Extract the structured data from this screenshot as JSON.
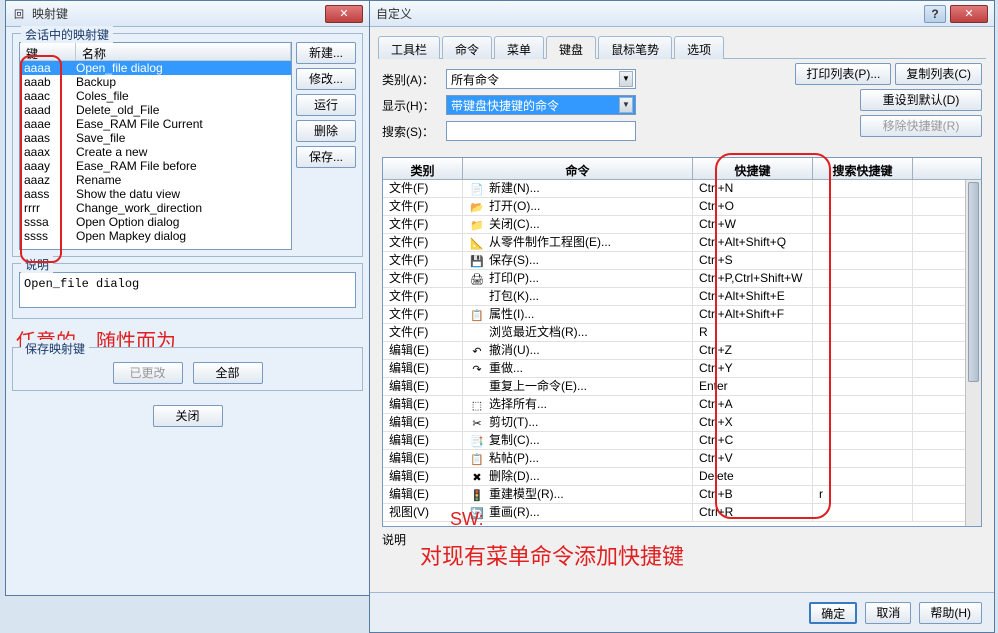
{
  "left": {
    "title": "映射键",
    "group_session": "会话中的映射键",
    "col_key": "键",
    "col_name": "名称",
    "rows": [
      {
        "k": "aaaa",
        "n": "Open_file dialog"
      },
      {
        "k": "aaab",
        "n": "Backup"
      },
      {
        "k": "aaac",
        "n": "Coles_file"
      },
      {
        "k": "aaad",
        "n": "Delete_old_File"
      },
      {
        "k": "aaae",
        "n": "Ease_RAM File Current"
      },
      {
        "k": "aaas",
        "n": "Save_file"
      },
      {
        "k": "aaax",
        "n": "Create a new"
      },
      {
        "k": "aaay",
        "n": "Ease_RAM File before"
      },
      {
        "k": "aaaz",
        "n": "Rename"
      },
      {
        "k": "aass",
        "n": "Show the datu view"
      },
      {
        "k": "rrrr",
        "n": "Change_work_direction"
      },
      {
        "k": "sssa",
        "n": "Open Option dialog"
      },
      {
        "k": "ssss",
        "n": "Open Mapkey dialog"
      }
    ],
    "btn_new": "新建...",
    "btn_edit": "修改...",
    "btn_run": "运行",
    "btn_del": "删除",
    "btn_save": "保存...",
    "group_desc": "说明",
    "desc_text": "Open_file dialog",
    "group_savekeys": "保存映射键",
    "btn_changed": "已更改",
    "btn_all": "全部",
    "btn_close": "关闭",
    "anno": "任意的，随性而为"
  },
  "right": {
    "title": "自定义",
    "tabs": [
      "工具栏",
      "命令",
      "菜单",
      "键盘",
      "鼠标笔势",
      "选项"
    ],
    "lbl_category": "类别(A)：",
    "val_category": "所有命令",
    "lbl_show": "显示(H)：",
    "val_show": "带键盘快捷键的命令",
    "lbl_search": "搜索(S)：",
    "btn_printlist": "打印列表(P)...",
    "btn_copylist": "复制列表(C)",
    "btn_reset": "重设到默认(D)",
    "btn_remove": "移除快捷键(R)",
    "grid_cols": [
      "类别",
      "命令",
      "快捷键",
      "搜索快捷键"
    ],
    "grid_rows": [
      {
        "c": "文件(F)",
        "ico": "📄",
        "cmd": "新建(N)...",
        "key": "Ctrl+N",
        "s": ""
      },
      {
        "c": "文件(F)",
        "ico": "📂",
        "cmd": "打开(O)...",
        "key": "Ctrl+O",
        "s": ""
      },
      {
        "c": "文件(F)",
        "ico": "📁",
        "cmd": "关闭(C)...",
        "key": "Ctrl+W",
        "s": ""
      },
      {
        "c": "文件(F)",
        "ico": "📐",
        "cmd": "从零件制作工程图(E)...",
        "key": "Ctrl+Alt+Shift+Q",
        "s": ""
      },
      {
        "c": "文件(F)",
        "ico": "💾",
        "cmd": "保存(S)...",
        "key": "Ctrl+S",
        "s": ""
      },
      {
        "c": "文件(F)",
        "ico": "🖨",
        "cmd": "打印(P)...",
        "key": "Ctrl+P,Ctrl+Shift+W",
        "s": ""
      },
      {
        "c": "文件(F)",
        "ico": "",
        "cmd": "打包(K)...",
        "key": "Ctrl+Alt+Shift+E",
        "s": ""
      },
      {
        "c": "文件(F)",
        "ico": "📋",
        "cmd": "属性(I)...",
        "key": "Ctrl+Alt+Shift+F",
        "s": ""
      },
      {
        "c": "文件(F)",
        "ico": "",
        "cmd": "浏览最近文档(R)...",
        "key": "R",
        "s": ""
      },
      {
        "c": "编辑(E)",
        "ico": "↶",
        "cmd": "撤消(U)...",
        "key": "Ctrl+Z",
        "s": ""
      },
      {
        "c": "编辑(E)",
        "ico": "↷",
        "cmd": "重做...",
        "key": "Ctrl+Y",
        "s": ""
      },
      {
        "c": "编辑(E)",
        "ico": "",
        "cmd": "重复上一命令(E)...",
        "key": "Enter",
        "s": ""
      },
      {
        "c": "编辑(E)",
        "ico": "⬚",
        "cmd": "选择所有...",
        "key": "Ctrl+A",
        "s": ""
      },
      {
        "c": "编辑(E)",
        "ico": "✂",
        "cmd": "剪切(T)...",
        "key": "Ctrl+X",
        "s": ""
      },
      {
        "c": "编辑(E)",
        "ico": "📑",
        "cmd": "复制(C)...",
        "key": "Ctrl+C",
        "s": ""
      },
      {
        "c": "编辑(E)",
        "ico": "📋",
        "cmd": "粘帖(P)...",
        "key": "Ctrl+V",
        "s": ""
      },
      {
        "c": "编辑(E)",
        "ico": "✖",
        "cmd": "删除(D)...",
        "key": "Delete",
        "s": ""
      },
      {
        "c": "编辑(E)",
        "ico": "🚦",
        "cmd": "重建模型(R)...",
        "key": "Ctrl+B",
        "s": "r"
      },
      {
        "c": "视图(V)",
        "ico": "🔄",
        "cmd": "重画(R)...",
        "key": "Ctrl+R",
        "s": ""
      }
    ],
    "lbl_desc": "说明",
    "anno_sw": "SW:",
    "anno_text": "对现有菜单命令添加快捷键",
    "btn_ok": "确定",
    "btn_cancel": "取消",
    "btn_help": "帮助(H)"
  }
}
